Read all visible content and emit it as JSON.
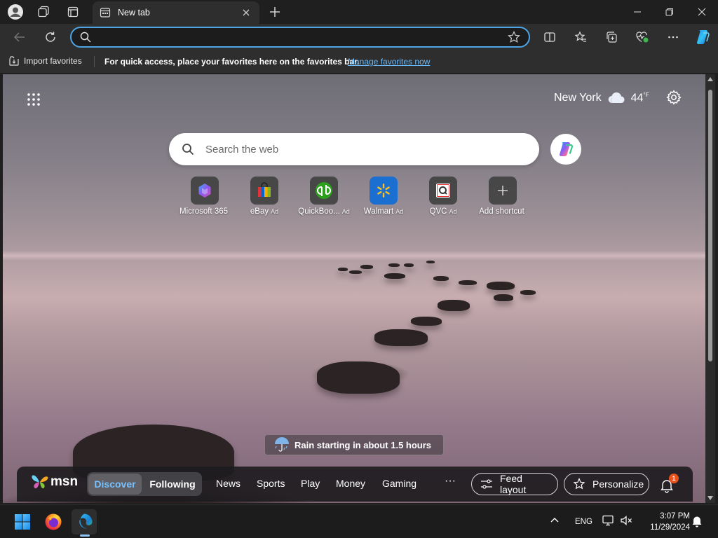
{
  "browser": {
    "tab_title": "New tab",
    "address_placeholder": "",
    "favorites_bar": {
      "import_label": "Import favorites",
      "message": "For quick access, place your favorites here on the favorites bar.",
      "manage_link": "Manage favorites now"
    }
  },
  "newtab": {
    "weather": {
      "city": "New York",
      "temp": "44",
      "unit": "°F"
    },
    "search_placeholder": "Search the web",
    "shortcuts": [
      {
        "label": "Microsoft 365",
        "ad": ""
      },
      {
        "label": "eBay",
        "ad": "Ad"
      },
      {
        "label": "QuickBoo...",
        "ad": "Ad"
      },
      {
        "label": "Walmart",
        "ad": "Ad"
      },
      {
        "label": "QVC",
        "ad": "Ad"
      },
      {
        "label": "Add shortcut",
        "ad": ""
      }
    ],
    "weather_alert": "Rain starting in about 1.5 hours",
    "msn": {
      "logo_text": "msn",
      "tabs": [
        "Discover",
        "Following"
      ],
      "links": [
        "News",
        "Sports",
        "Play",
        "Money",
        "Gaming"
      ],
      "more": "···",
      "feed_layout": "Feed layout",
      "personalize": "Personalize",
      "notification_count": "1"
    }
  },
  "taskbar": {
    "language": "ENG",
    "time": "3:07 PM",
    "date": "11/29/2024"
  },
  "colors": {
    "accent": "#4ea4e5",
    "link": "#6cb8f6",
    "discover_active": "#77c1ff",
    "badge": "#e9521d"
  }
}
